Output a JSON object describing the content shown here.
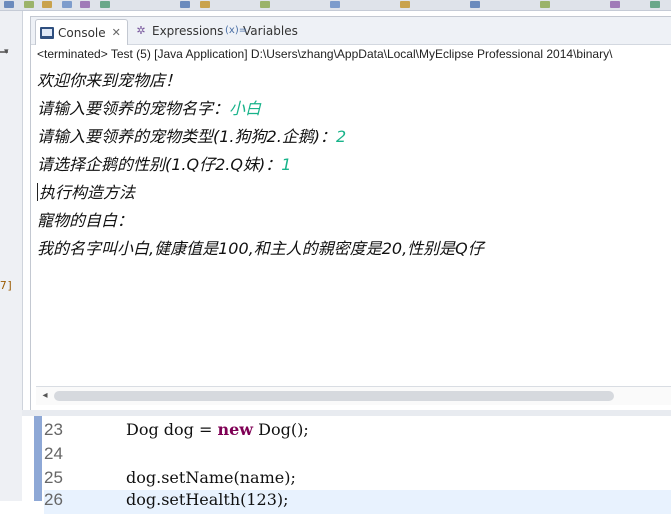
{
  "tabs": [
    {
      "label": "Console",
      "icon": "console-icon",
      "active": true
    },
    {
      "label": "Expressions",
      "icon": "expressions-icon",
      "active": false
    },
    {
      "label": "Variables",
      "icon": "variables-icon",
      "active": false
    }
  ],
  "console": {
    "status": "<terminated> Test (5) [Java Application] D:\\Users\\zhang\\AppData\\Local\\MyEclipse Professional 2014\\binary\\",
    "lines": [
      {
        "text": "欢迎你来到宠物店！",
        "input": ""
      },
      {
        "text": "请输入要领养的宠物名字：",
        "input": "小白"
      },
      {
        "text": "请输入要领养的宠物类型(1.狗狗2.企鹅)：",
        "input": "2"
      },
      {
        "text": "请选择企鹅的性别(1.Q仔2.Q妹)：",
        "input": "1"
      },
      {
        "text": "执行构造方法",
        "input": ""
      },
      {
        "text": "寵物的自白：",
        "input": ""
      },
      {
        "text": "我的名字叫小白,健康值是100,和主人的親密度是20,性别是Q仔",
        "input": ""
      }
    ]
  },
  "left_marker": "7]",
  "editor": {
    "lines": [
      {
        "num": "23",
        "pre": "Dog dog = ",
        "kw": "new",
        "post": " Dog();"
      },
      {
        "num": "24",
        "pre": "",
        "kw": "",
        "post": ""
      },
      {
        "num": "25",
        "pre": "dog.setName(name);",
        "kw": "",
        "post": ""
      },
      {
        "num": "26",
        "pre": "dog.setHealth(123);",
        "kw": "",
        "post": ""
      }
    ]
  },
  "colors": {
    "input_text": "#18b38a",
    "keyword": "#7f0055",
    "gutter": "#8ea8d6"
  }
}
